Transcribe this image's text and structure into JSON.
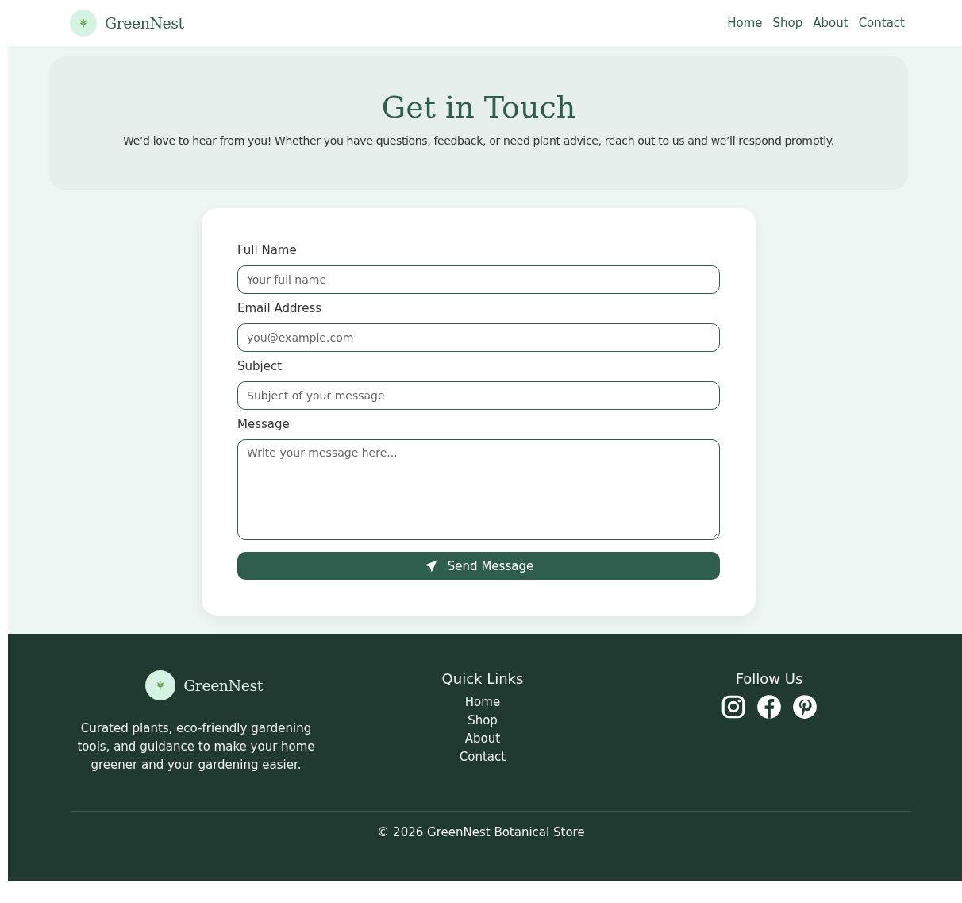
{
  "header": {
    "brand": "GreenNest",
    "nav": [
      {
        "label": "Home"
      },
      {
        "label": "Shop"
      },
      {
        "label": "About"
      },
      {
        "label": "Contact"
      }
    ]
  },
  "hero": {
    "title": "Get in Touch",
    "subtitle": "We’d love to hear from you! Whether you have questions, feedback, or need plant advice, reach out to us and we’ll respond promptly."
  },
  "form": {
    "fields": [
      {
        "kind": "input",
        "label": "Full Name",
        "placeholder": "Your full name"
      },
      {
        "kind": "input",
        "label": "Email Address",
        "placeholder": "you@example.com"
      },
      {
        "kind": "input",
        "label": "Subject",
        "placeholder": "Subject of your message"
      },
      {
        "kind": "textarea",
        "label": "Message",
        "placeholder": "Write your message here..."
      }
    ],
    "submit": "Send Message"
  },
  "footer": {
    "brand": "GreenNest",
    "description": "Curated plants, eco-friendly gardening tools, and guidance to make your home greener and your gardening easier.",
    "quick_links_title": "Quick Links",
    "quick_links": [
      {
        "label": "Home"
      },
      {
        "label": "Shop"
      },
      {
        "label": "About"
      },
      {
        "label": "Contact"
      }
    ],
    "follow_title": "Follow Us",
    "social": [
      {
        "kind": "instagram"
      },
      {
        "kind": "facebook"
      },
      {
        "kind": "pinterest"
      }
    ],
    "copyright": "© 2026 GreenNest Botanical Store"
  }
}
